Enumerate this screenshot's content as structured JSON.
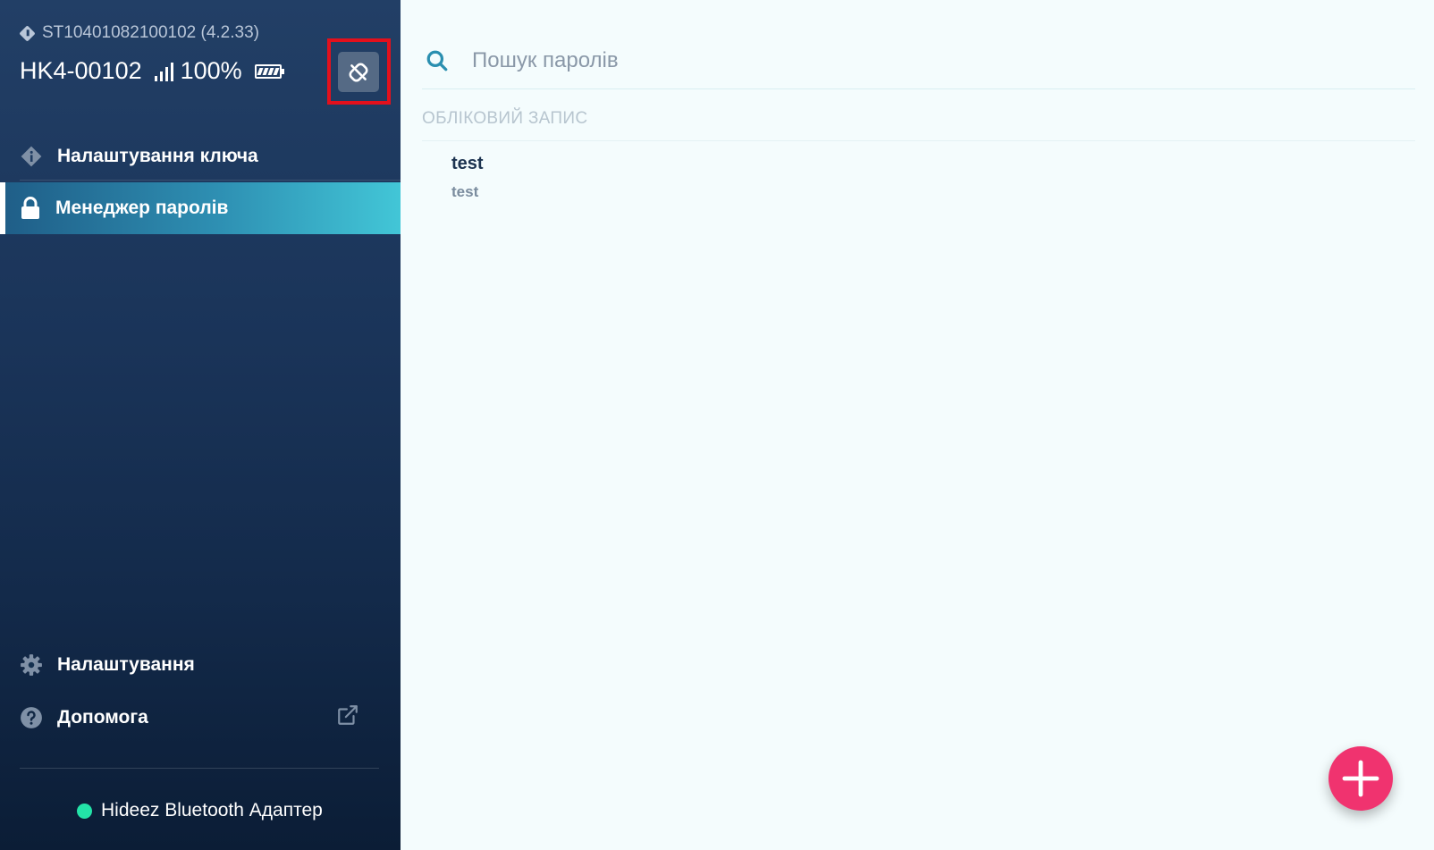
{
  "device": {
    "serial": "ST10401082100102 (4.2.33)",
    "name": "HK4-00102",
    "battery_percent": "100%"
  },
  "nav": {
    "key_settings": "Налаштування ключа",
    "password_manager": "Менеджер паролів",
    "settings": "Налаштування",
    "help": "Допомога"
  },
  "adapter": {
    "label": "Hideez Bluetooth Адаптер",
    "status_color": "#23e3a8"
  },
  "search": {
    "placeholder": "Пошук паролів"
  },
  "accounts": {
    "section_title": "ОБЛІКОВИЙ ЗАПИС",
    "items": [
      {
        "name": "test",
        "login": "test"
      }
    ]
  },
  "colors": {
    "accent": "#42c6d7",
    "fab": "#f0336f",
    "sidebar": "#1a3459",
    "highlight": "#e3101c"
  },
  "icons": {
    "disconnect": "unlink-icon",
    "add": "plus-icon"
  }
}
